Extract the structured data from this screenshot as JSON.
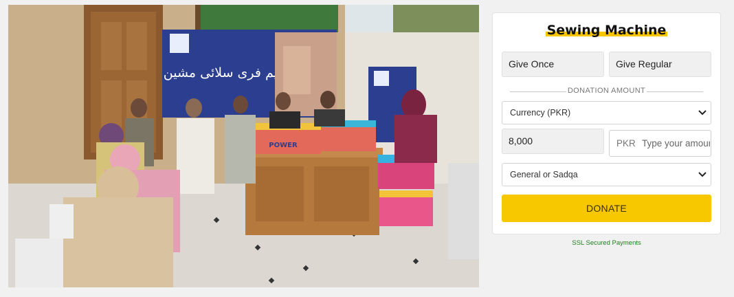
{
  "photo": {
    "banner_text": "تقسیم فری سلائی مشین",
    "box_brand": "POWER"
  },
  "donation_card": {
    "title": "Sewing Machine",
    "give_once_label": "Give Once",
    "give_regular_label": "Give Regular",
    "section_label": "DONATION AMOUNT",
    "currency_select_value": "Currency (PKR)",
    "preset_amount": "8,000",
    "custom_amount_currency": "PKR",
    "custom_amount_placeholder": "Type your amount",
    "purpose_select_value": "General or Sadqa",
    "donate_label": "DONATE"
  },
  "footer": {
    "ssl_text": "SSL Secured Payments"
  },
  "colors": {
    "accent_yellow": "#F7C800",
    "ssl_green": "#1B7F1B",
    "banner_blue": "#2B3E8F"
  }
}
